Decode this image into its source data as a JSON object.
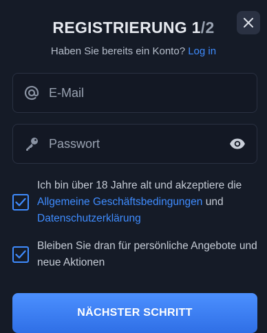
{
  "header": {
    "title_main": "REGISTRIERUNG 1",
    "title_total": "/2",
    "close_icon": "close-icon"
  },
  "login_prompt": {
    "text": "Haben Sie bereits ein Konto?",
    "link": "Log in"
  },
  "form": {
    "email": {
      "placeholder": "E-Mail",
      "value": "",
      "icon": "at-icon"
    },
    "password": {
      "placeholder": "Passwort",
      "value": "",
      "icon": "key-icon",
      "toggle_icon": "eye-icon"
    }
  },
  "consents": {
    "terms": {
      "checked": true,
      "text_before": "Ich bin über 18 Jahre alt und akzeptiere die",
      "link1": "Allgemeine Geschäftsbedingungen",
      "text_middle": "und",
      "link2": "Datenschutzerklärung"
    },
    "promo": {
      "checked": true,
      "text": "Bleiben Sie dran für persönliche Angebote und neue Aktionen"
    }
  },
  "actions": {
    "next_label": "NÄCHSTER SCHRITT"
  },
  "colors": {
    "background": "#151b27",
    "accent": "#3f8cff",
    "field_border": "#2a3142"
  }
}
